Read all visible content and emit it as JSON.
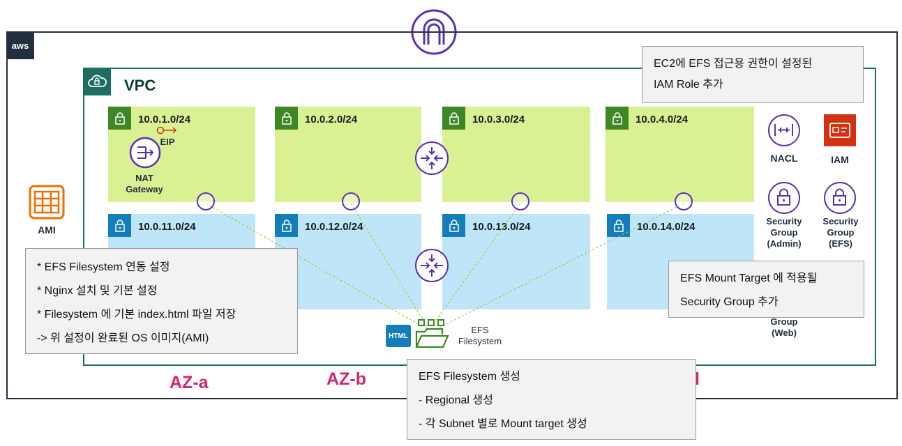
{
  "aws_logo": "aws",
  "vpc": {
    "label": "VPC"
  },
  "subnets": {
    "public": [
      "10.0.1.0/24",
      "10.0.2.0/24",
      "10.0.3.0/24",
      "10.0.4.0/24"
    ],
    "private": [
      "10.0.11.0/24",
      "10.0.12.0/24",
      "10.0.13.0/24",
      "10.0.14.0/24"
    ]
  },
  "labels": {
    "eip": "EIP",
    "nat_line1": "NAT",
    "nat_line2": "Gateway",
    "ami": "AMI",
    "nacl": "NACL",
    "iam": "IAM",
    "sg_admin": [
      "Security",
      "Group",
      "(Admin)"
    ],
    "sg_efs": [
      "Security",
      "Group",
      "(EFS)"
    ],
    "sg_web": [
      "Group",
      "(Web)"
    ],
    "efs_line1": "EFS",
    "efs_line2": "Filesystem",
    "html_badge": "HTML"
  },
  "az": {
    "a": "AZ-a",
    "b": "AZ-b",
    "d_fragment": "l"
  },
  "callouts": {
    "iam": [
      "EC2에 EFS 접근용 권한이 설정된",
      "IAM Role 추가"
    ],
    "ami": [
      "* EFS Filesystem 연동 설정",
      "* Nginx 설치 및 기본 설정",
      "* Filesystem 에 기본 index.html 파일 저장",
      "-> 위 설정이 완료된 OS 이미지(AMI)"
    ],
    "sg": [
      "EFS Mount Target 에 적용될",
      "Security Group 추가"
    ],
    "efs": [
      "EFS Filesystem 생성",
      "- Regional 생성",
      "- 각 Subnet 별로 Mount target 생성"
    ]
  },
  "colors": {
    "public_subnet": "#d9f093",
    "private_subnet": "#bfe6f8",
    "vpc_border": "#1b6e60",
    "accent_purple": "#5a30b5",
    "az_label": "#d6246e",
    "efs_green": "#3f8624",
    "iam_red": "#d13212",
    "ami_orange": "#ed7100"
  }
}
